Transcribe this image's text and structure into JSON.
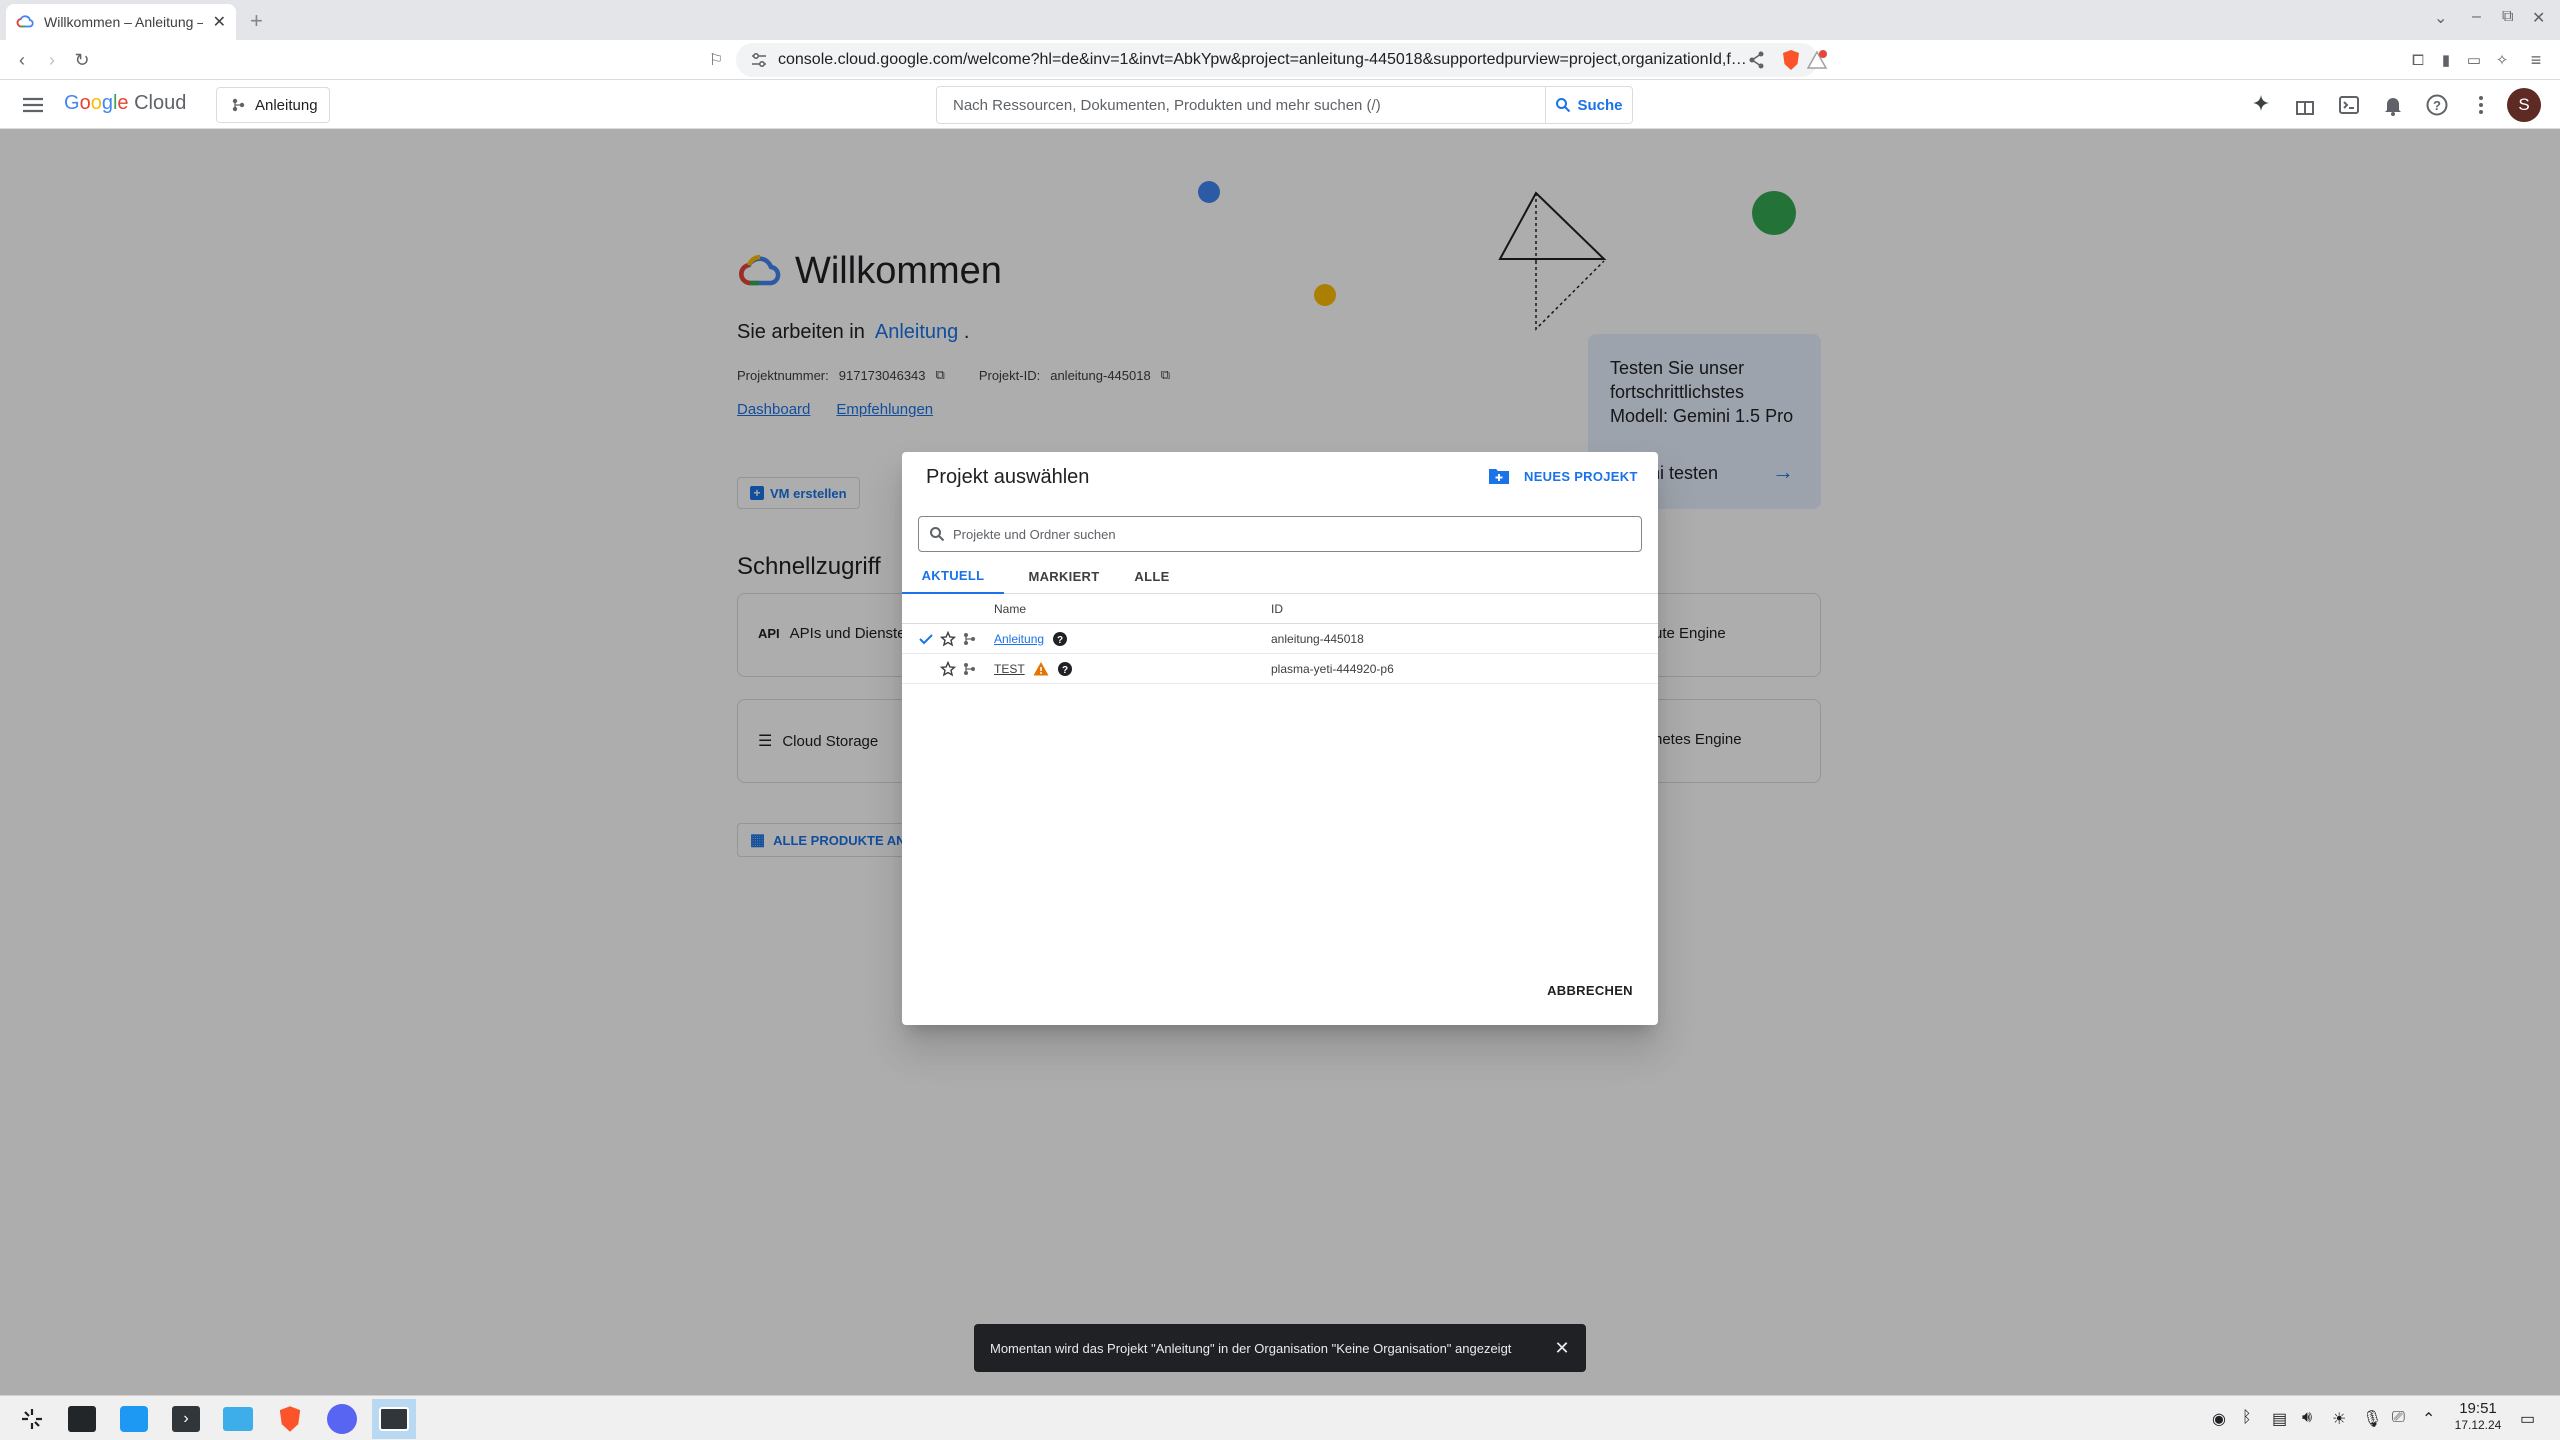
{
  "browser": {
    "tab_title": "Willkommen – Anleitung – …",
    "url": "console.cloud.google.com/welcome?hl=de&inv=1&invt=AbkYpw&project=anleitung-445018&supportedpurview=project,organizationId,f…"
  },
  "header": {
    "logo_google": [
      "G",
      "o",
      "o",
      "g",
      "l",
      "e"
    ],
    "logo_cloud": "Cloud",
    "project_chip": "Anleitung",
    "search_placeholder": "Nach Ressourcen, Dokumenten, Produkten und mehr suchen (/)",
    "search_button": "Suche",
    "avatar_letter": "S"
  },
  "page": {
    "welcome_title": "Willkommen",
    "working_in": "Sie arbeiten in",
    "working_project": "Anleitung",
    "working_dot": ".",
    "project_number_label": "Projektnummer:",
    "project_number": "917173046343",
    "project_id_label": "Projekt-ID:",
    "project_id": "anleitung-445018",
    "link_dashboard": "Dashboard",
    "link_recommendations": "Empfehlungen",
    "vm_button": "VM erstellen",
    "quick_access": "Schnellzugriff",
    "qa_apis": "APIs und Dienste",
    "qa_compute": "ute Engine",
    "qa_storage": "Cloud Storage",
    "qa_kubernetes": "netes Engine",
    "all_products": "ALLE PRODUKTE ANS",
    "gemini_text": "Testen Sie unser fortschrittlichstes Modell: Gemini 1.5 Pro",
    "gemini_cta": "ni testen"
  },
  "dialog": {
    "title": "Projekt auswählen",
    "new_project": "NEUES PROJEKT",
    "search_placeholder": "Projekte und Ordner suchen",
    "tabs": [
      "AKTUELL",
      "MARKIERT",
      "ALLE"
    ],
    "col_name": "Name",
    "col_id": "ID",
    "rows": [
      {
        "name": "Anleitung",
        "id": "anleitung-445018",
        "selected": true,
        "warning": false
      },
      {
        "name": "TEST",
        "id": "plasma-yeti-444920-p6",
        "selected": false,
        "warning": true
      }
    ],
    "cancel": "ABBRECHEN"
  },
  "snackbar": {
    "message": "Momentan wird das Projekt \"Anleitung\" in der Organisation \"Keine Organisation\" angezeigt"
  },
  "taskbar": {
    "time": "19:51",
    "date": "17.12.24"
  },
  "colors": {
    "accent": "#1a73e8",
    "warning": "#e37400",
    "gemini_bg": "#e8f0fe"
  }
}
